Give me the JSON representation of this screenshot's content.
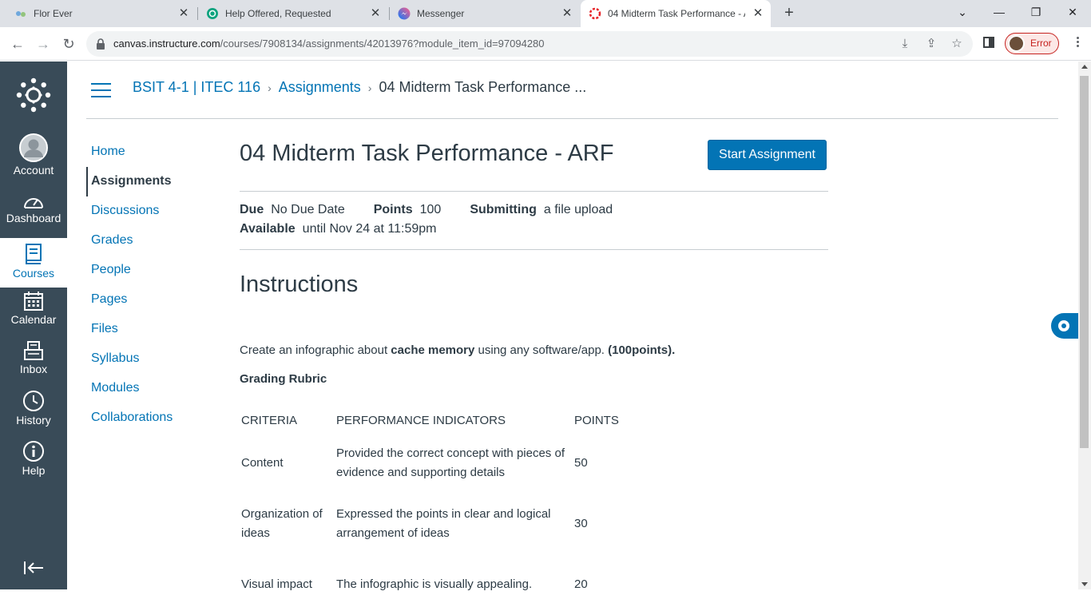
{
  "browser": {
    "tabs": [
      {
        "title": "Flor Ever",
        "active": false
      },
      {
        "title": "Help Offered, Requested",
        "active": false
      },
      {
        "title": "Messenger",
        "active": false
      },
      {
        "title": "04 Midterm Task Performance - A",
        "active": true
      }
    ],
    "url_host": "canvas.instructure.com",
    "url_path": "/courses/7908134/assignments/42013976?module_item_id=97094280",
    "profile_status": "Error"
  },
  "global_nav": {
    "items": [
      {
        "label": "Account"
      },
      {
        "label": "Dashboard"
      },
      {
        "label": "Courses"
      },
      {
        "label": "Calendar"
      },
      {
        "label": "Inbox"
      },
      {
        "label": "History"
      },
      {
        "label": "Help"
      }
    ]
  },
  "breadcrumb": {
    "course": "BSIT 4-1 | ITEC 116",
    "section": "Assignments",
    "current": "04 Midterm Task Performance ..."
  },
  "course_nav": {
    "items": [
      "Home",
      "Assignments",
      "Discussions",
      "Grades",
      "People",
      "Pages",
      "Files",
      "Syllabus",
      "Modules",
      "Collaborations"
    ]
  },
  "assignment": {
    "title": "04 Midterm Task Performance - ARF",
    "start_button": "Start Assignment",
    "due_label": "Due",
    "due_value": "No Due Date",
    "points_label": "Points",
    "points_value": "100",
    "submitting_label": "Submitting",
    "submitting_value": "a file upload",
    "available_label": "Available",
    "available_value": "until Nov 24 at 11:59pm",
    "instructions_heading": "Instructions",
    "desc_pre": "Create an infographic about ",
    "desc_bold": "cache memory",
    "desc_mid": " using any software/app. ",
    "desc_points": "(100points).",
    "rubric_heading": "Grading Rubric",
    "rubric": {
      "headers": [
        "CRITERIA",
        "PERFORMANCE INDICATORS",
        "POINTS"
      ],
      "rows": [
        {
          "criteria": "Content",
          "indicator": "Provided the correct concept with pieces of evidence and supporting details",
          "points": "50"
        },
        {
          "criteria": "Organization of ideas",
          "indicator": "Expressed the points in clear and logical arrangement of ideas",
          "points": "30"
        },
        {
          "criteria": "Visual impact",
          "indicator": "The infographic is visually appealing.",
          "points": "20"
        }
      ]
    }
  },
  "colors": {
    "brand": "#0374b5",
    "nav_bg": "#394b58",
    "text": "#2d3b45"
  }
}
